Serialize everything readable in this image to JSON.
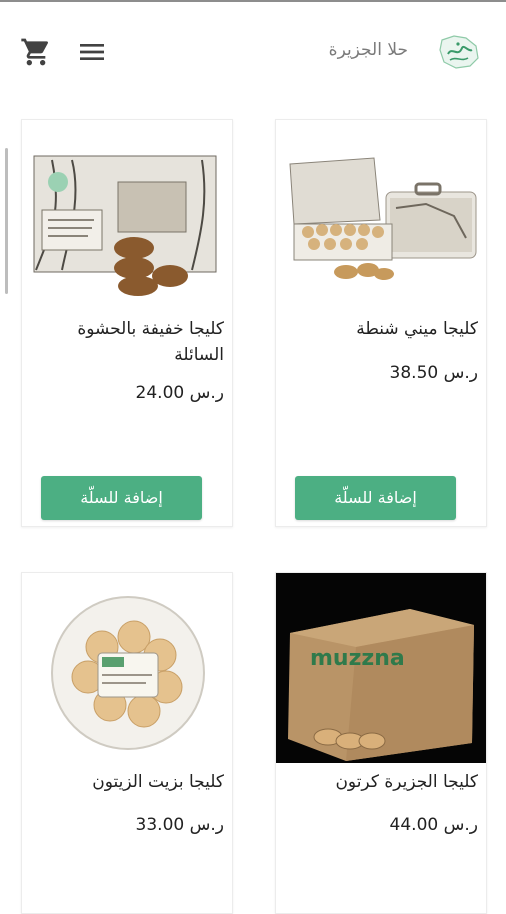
{
  "header": {
    "brand_name": "حلا الجزيرة",
    "accent": "#4caf83"
  },
  "products": [
    {
      "title": "كليجا ميني شنطة",
      "price": "38.50 ر.س",
      "button": "إضافة للسلّة"
    },
    {
      "title": "كليجا خفيفة بالحشوة السائلة",
      "price": "24.00 ر.س",
      "button": "إضافة للسلّة"
    },
    {
      "title": "كليجا الجزيرة كرتون",
      "price": "44.00 ر.س",
      "image_text": "muzzna"
    },
    {
      "title": "كليجا بزيت الزيتون",
      "price": "33.00 ر.س"
    }
  ],
  "icons": [
    "cart-icon",
    "menu-icon",
    "logo"
  ]
}
